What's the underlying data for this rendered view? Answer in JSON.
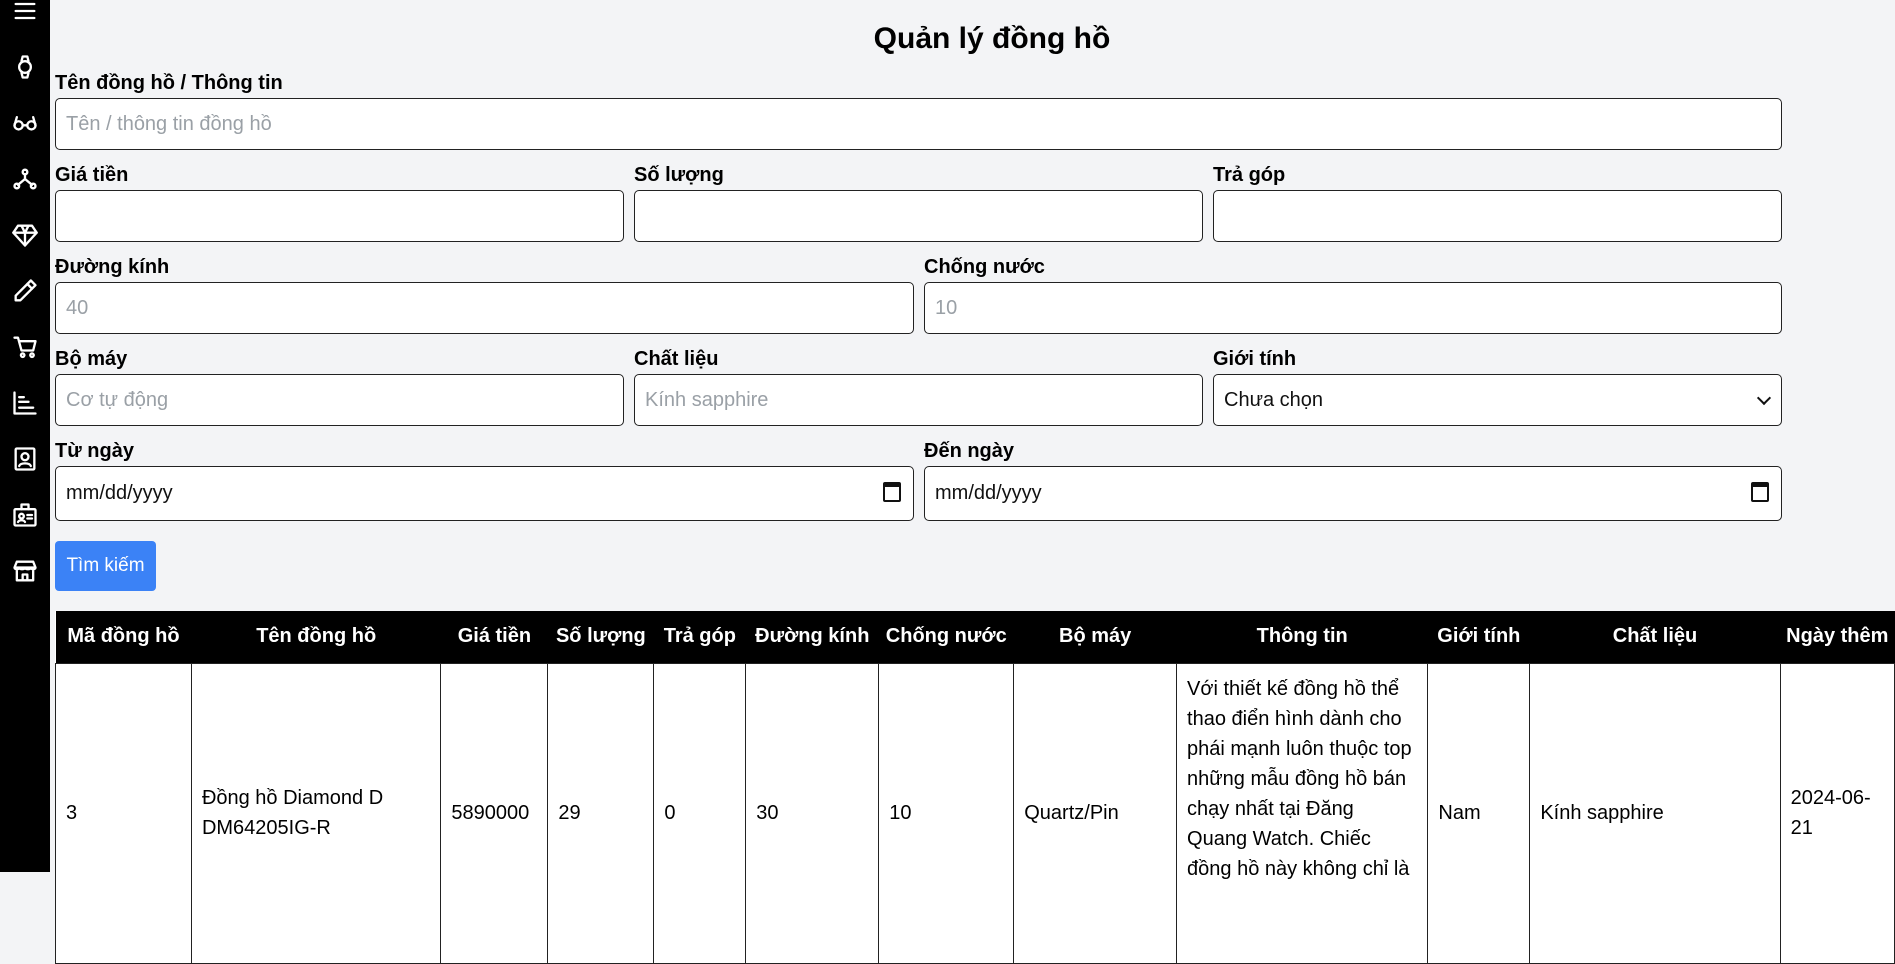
{
  "sidebar": {
    "icons": [
      "menu-icon",
      "watch-icon",
      "glasses-icon",
      "hub-icon",
      "diamond-icon",
      "pen-icon",
      "cart-icon",
      "chart-icon",
      "contact-card-icon",
      "id-badge-icon",
      "store-icon"
    ]
  },
  "page": {
    "title": "Quản lý đồng hồ"
  },
  "form": {
    "name_label": "Tên đồng hồ / Thông tin",
    "name_placeholder": "Tên / thông tin đồng hồ",
    "price_label": "Giá tiền",
    "qty_label": "Số lượng",
    "installment_label": "Trả góp",
    "diameter_label": "Đường kính",
    "diameter_placeholder": "40",
    "water_label": "Chống nước",
    "water_placeholder": "10",
    "movement_label": "Bộ máy",
    "movement_placeholder": "Cơ tự động",
    "material_label": "Chất liệu",
    "material_placeholder": "Kính sapphire",
    "gender_label": "Giới tính",
    "gender_value": "Chưa chọn",
    "from_label": "Từ ngày",
    "from_value": "mm/dd/yyyy",
    "to_label": "Đến ngày",
    "to_value": "mm/dd/yyyy",
    "search_button": "Tìm kiếm"
  },
  "table": {
    "headers": [
      "Mã đồng hồ",
      "Tên đồng hồ",
      "Giá tiền",
      "Số lượng",
      "Trả góp",
      "Đường kính",
      "Chống nước",
      "Bộ máy",
      "Thông tin",
      "Giới tính",
      "Chất liệu",
      "Ngày thêm"
    ],
    "rows": [
      [
        "3",
        "Đồng hồ Diamond D DM64205IG-R",
        "5890000",
        "29",
        "0",
        "30",
        "10",
        "Quartz/Pin",
        "Với thiết kế đồng hồ thể thao điển hình dành cho phái mạnh luôn thuộc top những mẫu đồng hồ bán chạy nhất tại Đăng Quang Watch. Chiếc đồng hồ này không chỉ là",
        "Nam",
        "Kính sapphire",
        "2024-06-21"
      ]
    ]
  }
}
